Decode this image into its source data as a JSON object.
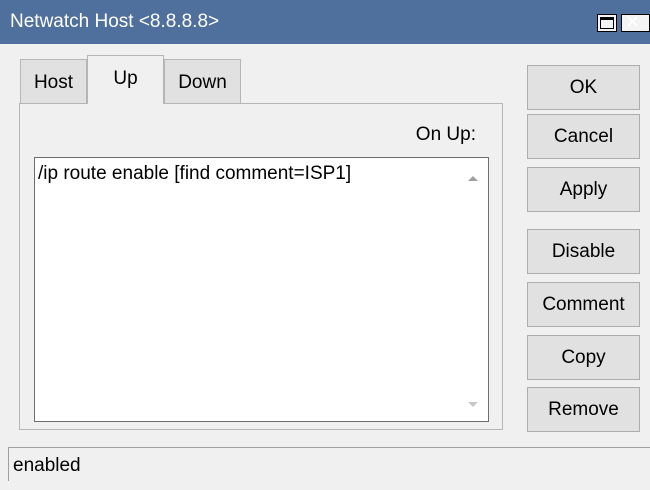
{
  "window": {
    "title": "Netwatch Host <8.8.8.8>",
    "maximize_icon": "maximize-icon",
    "close_icon": "close-icon"
  },
  "tabs": [
    {
      "label": "Host",
      "active": false
    },
    {
      "label": "Up",
      "active": true
    },
    {
      "label": "Down",
      "active": false
    }
  ],
  "panel": {
    "field_label": "On Up:",
    "script": "/ip route  enable [find comment=ISP1]"
  },
  "buttons": {
    "ok": "OK",
    "cancel": "Cancel",
    "apply": "Apply",
    "disable": "Disable",
    "comment": "Comment",
    "copy": "Copy",
    "remove": "Remove"
  },
  "status": {
    "text": "enabled"
  },
  "colors": {
    "titlebar": "#4f6f9d",
    "background": "#f0f0f0",
    "button": "#e1e1e1"
  }
}
